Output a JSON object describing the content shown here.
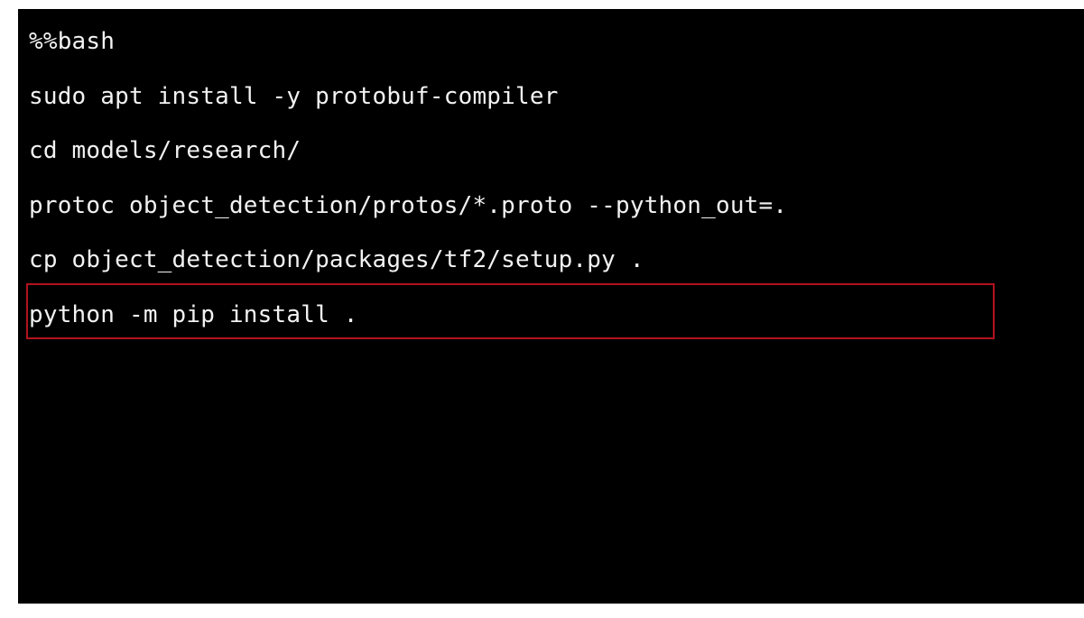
{
  "cell": {
    "lines": [
      "%%bash",
      "sudo apt install -y protobuf-compiler",
      "cd models/research/",
      "protoc object_detection/protos/*.proto --python_out=.",
      "cp object_detection/packages/tf2/setup.py .",
      "python -m pip install ."
    ],
    "highlighted_line_index": 5
  },
  "colors": {
    "background": "#000000",
    "text": "#f2f2f2",
    "highlight_border": "#b3121e"
  }
}
